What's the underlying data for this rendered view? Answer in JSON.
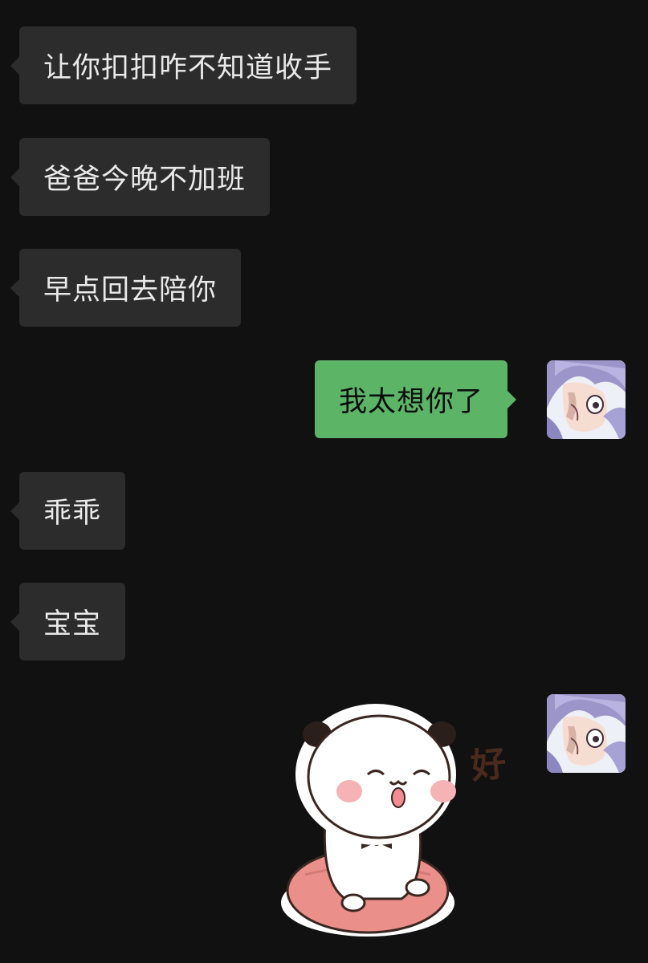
{
  "messages": [
    {
      "side": "in",
      "text": "让你扣扣咋不知道收手"
    },
    {
      "side": "in",
      "text": "爸爸今晚不加班"
    },
    {
      "side": "in",
      "text": "早点回去陪你"
    },
    {
      "side": "out",
      "text": "我太想你了"
    },
    {
      "side": "in",
      "text": "乖乖"
    },
    {
      "side": "in",
      "text": "宝宝"
    },
    {
      "side": "out",
      "sticker": "panda-bear-sticker",
      "sticker_text": "好"
    }
  ],
  "colors": {
    "background": "#111111",
    "incoming_bubble": "#2c2c2c",
    "outgoing_bubble": "#5cb567",
    "incoming_text": "#e9e9e9",
    "outgoing_text": "#0d0d0d"
  }
}
